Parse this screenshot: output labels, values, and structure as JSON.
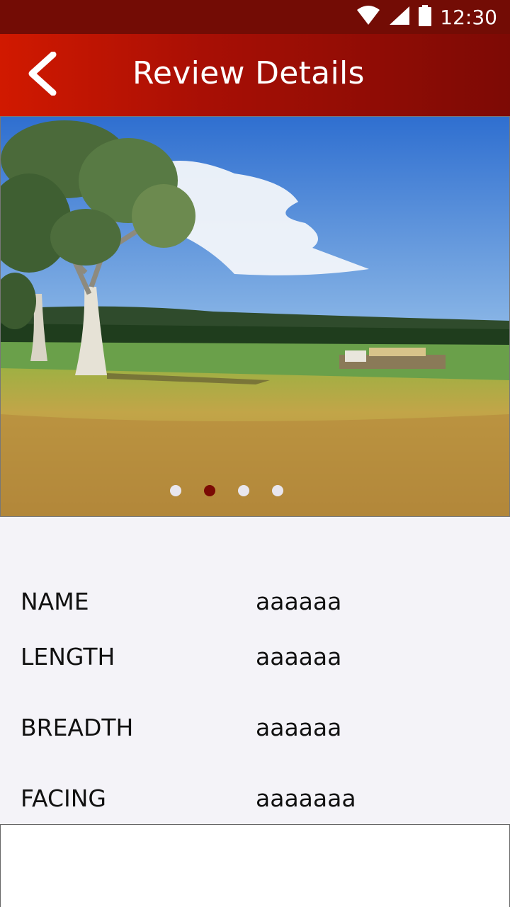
{
  "status_bar": {
    "time": "12:30",
    "icons": [
      "wifi-icon",
      "signal-icon",
      "battery-icon"
    ]
  },
  "app_bar": {
    "title": "Review Details",
    "back_icon": "chevron-left-icon"
  },
  "carousel": {
    "image_description_icon": "landscape-photo",
    "dot_count": 4,
    "active_index": 1
  },
  "details": [
    {
      "label": "NAME",
      "value": "aaaaaa"
    },
    {
      "label": "LENGTH",
      "value": "aaaaaa"
    },
    {
      "label": "BREADTH",
      "value": "aaaaaa"
    },
    {
      "label": "FACING",
      "value": "aaaaaaa"
    }
  ],
  "colors": {
    "status_bar": "#730c05",
    "app_bar_start": "#d11900",
    "app_bar_end": "#7d0a05",
    "active_dot": "#7b0a04",
    "background": "#f4f3f8"
  }
}
